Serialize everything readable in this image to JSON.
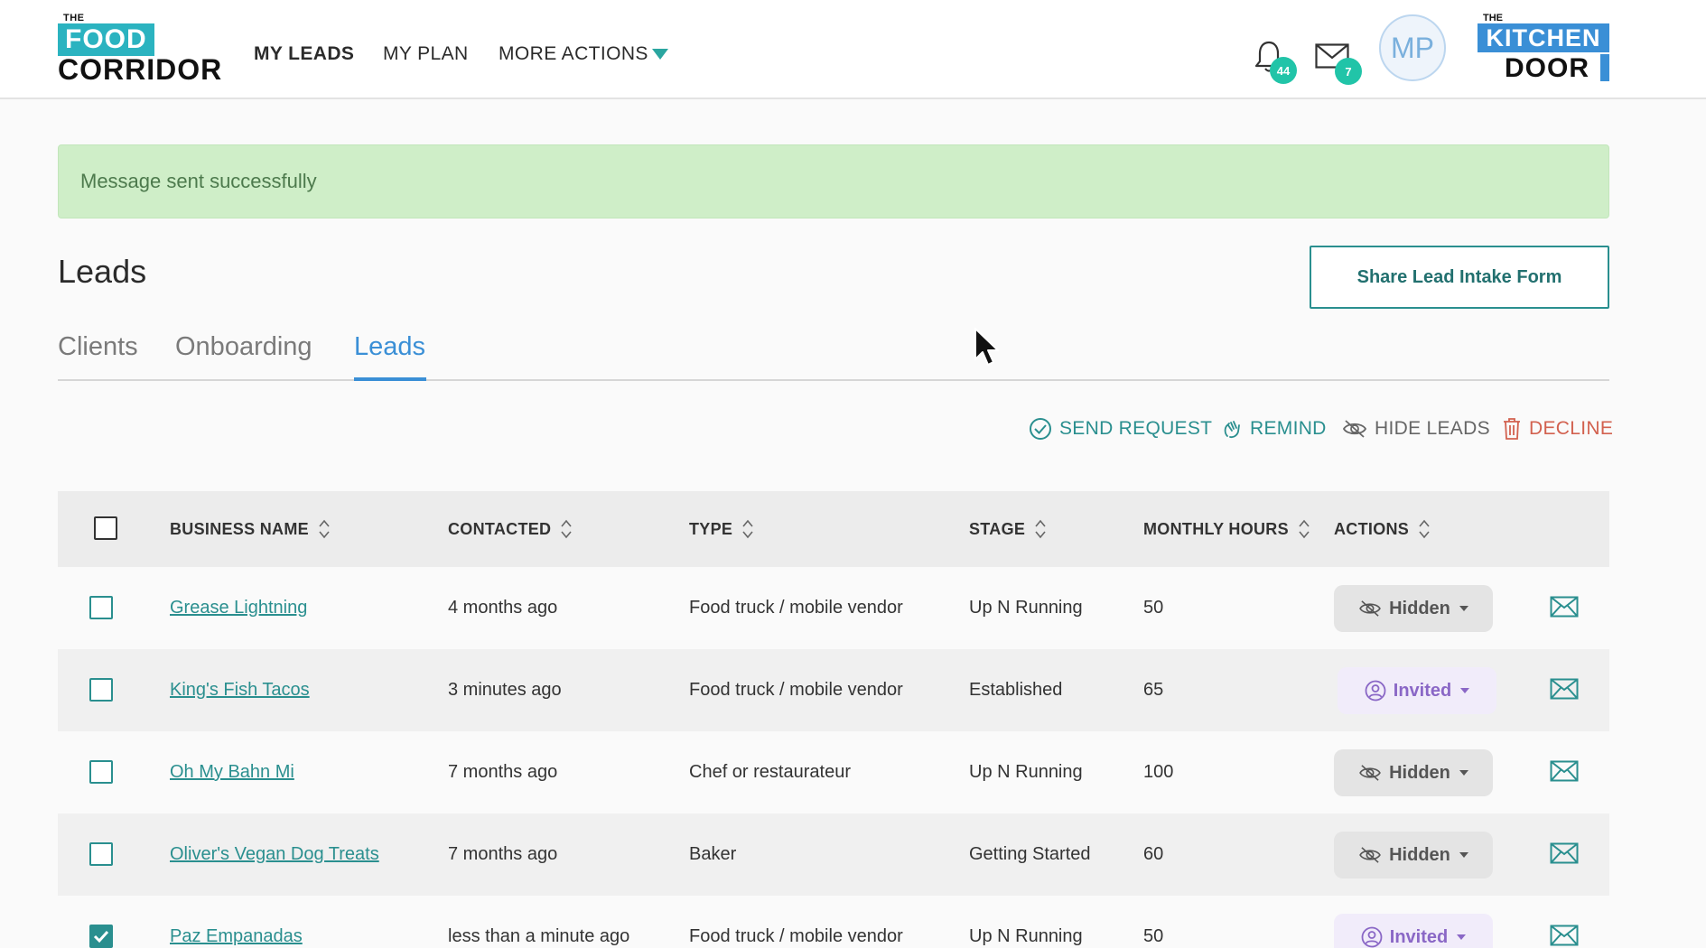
{
  "header": {
    "logo_left": {
      "the": "THE",
      "food": "FOOD",
      "corridor": "CORRIDOR"
    },
    "nav": [
      {
        "label": "MY LEADS",
        "active": true
      },
      {
        "label": "MY PLAN",
        "active": false
      },
      {
        "label": "MORE ACTIONS",
        "active": false
      }
    ],
    "notifications_count": "44",
    "messages_count": "7",
    "avatar_initials": "MP",
    "logo_right": {
      "the": "THE",
      "kitchen": "KITCHEN",
      "door": "DOOR"
    }
  },
  "alert": {
    "text": "Message sent successfully"
  },
  "page": {
    "title": "Leads",
    "share_button": "Share Lead Intake Form"
  },
  "tabs": [
    {
      "label": "Clients",
      "active": false
    },
    {
      "label": "Onboarding",
      "active": false
    },
    {
      "label": "Leads",
      "active": true
    }
  ],
  "bulk_actions": {
    "send_request": "SEND REQUEST",
    "remind": "REMIND",
    "hide_leads": "HIDE LEADS",
    "decline": "DECLINE"
  },
  "table": {
    "columns": [
      "BUSINESS NAME",
      "CONTACTED",
      "TYPE",
      "STAGE",
      "MONTHLY HOURS",
      "ACTIONS"
    ],
    "rows": [
      {
        "business": "Grease Lightning",
        "contacted": "4 months ago",
        "type": "Food truck / mobile vendor",
        "stage": "Up N Running",
        "hours": "50",
        "status": "Hidden",
        "checked": false
      },
      {
        "business": "King's Fish Tacos",
        "contacted": "3 minutes ago",
        "type": "Food truck / mobile vendor",
        "stage": "Established",
        "hours": "65",
        "status": "Invited",
        "checked": false
      },
      {
        "business": "Oh My Bahn Mi",
        "contacted": "7 months ago",
        "type": "Chef or restaurateur",
        "stage": "Up N Running",
        "hours": "100",
        "status": "Hidden",
        "checked": false
      },
      {
        "business": "Oliver's Vegan Dog Treats",
        "contacted": "7 months ago",
        "type": "Baker",
        "stage": "Getting Started",
        "hours": "60",
        "status": "Hidden",
        "checked": false
      },
      {
        "business": "Paz Empanadas",
        "contacted": "less than a minute ago",
        "type": "Food truck / mobile vendor",
        "stage": "Up N Running",
        "hours": "50",
        "status": "Invited",
        "checked": true
      }
    ]
  },
  "colors": {
    "teal": "#2a8f8f",
    "accent_blue": "#3a8fd6",
    "decline_red": "#d2614f",
    "badge_green": "#21c4a8",
    "alert_bg": "#cfeec8",
    "invited_purple": "#8a67c6"
  }
}
